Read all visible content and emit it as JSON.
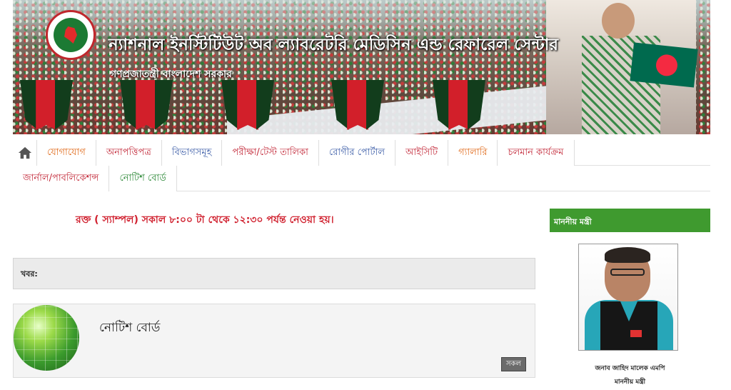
{
  "header": {
    "title": "ন্যাশনাল ইনস্টিটিউট অব ল্যাবরেটরি মেডিসিন এন্ড রেফারেল সেন্টার",
    "subtitle": "গণপ্রজাতন্ত্রী বাংলাদেশ সরকার"
  },
  "nav": {
    "row1": [
      {
        "label": "যোগাযোগ",
        "tone": "orange"
      },
      {
        "label": "অনাপত্তিপত্র",
        "tone": "red"
      },
      {
        "label": "বিভাগসমূহ",
        "tone": "blue"
      },
      {
        "label": "পরীক্ষা/টেস্ট তালিকা",
        "tone": "red"
      },
      {
        "label": "রোগীর পোর্টাল",
        "tone": "blue"
      },
      {
        "label": "আইসিটি",
        "tone": "red"
      },
      {
        "label": "গ্যালারি",
        "tone": "orange"
      },
      {
        "label": "চলমান কার্যক্রম",
        "tone": "red"
      }
    ],
    "row2": [
      {
        "label": "জার্নাল/পাবলিকেশন্স",
        "tone": "red"
      },
      {
        "label": "নোটিশ বোর্ড",
        "tone": "green"
      }
    ]
  },
  "marquee": {
    "text": "রক্ত ( স্যাম্পল) সকাল ৮:০০ টা থেকে ১২:৩০ পর্যন্ত নেওয়া হয়।"
  },
  "news": {
    "label": "খবর:"
  },
  "notice_board": {
    "title": "নোটিশ বোর্ড",
    "all_button": "সকল"
  },
  "sidebar": {
    "heading": "মাননীয় মন্ত্রী",
    "name": "জনাব জাহিদ মালেক এমপি",
    "designation": "মাননীয় মন্ত্রী"
  },
  "colors": {
    "accent_green": "#3f9a2f",
    "alert_red": "#d0202e",
    "nav_blue": "#3d5ea8"
  }
}
